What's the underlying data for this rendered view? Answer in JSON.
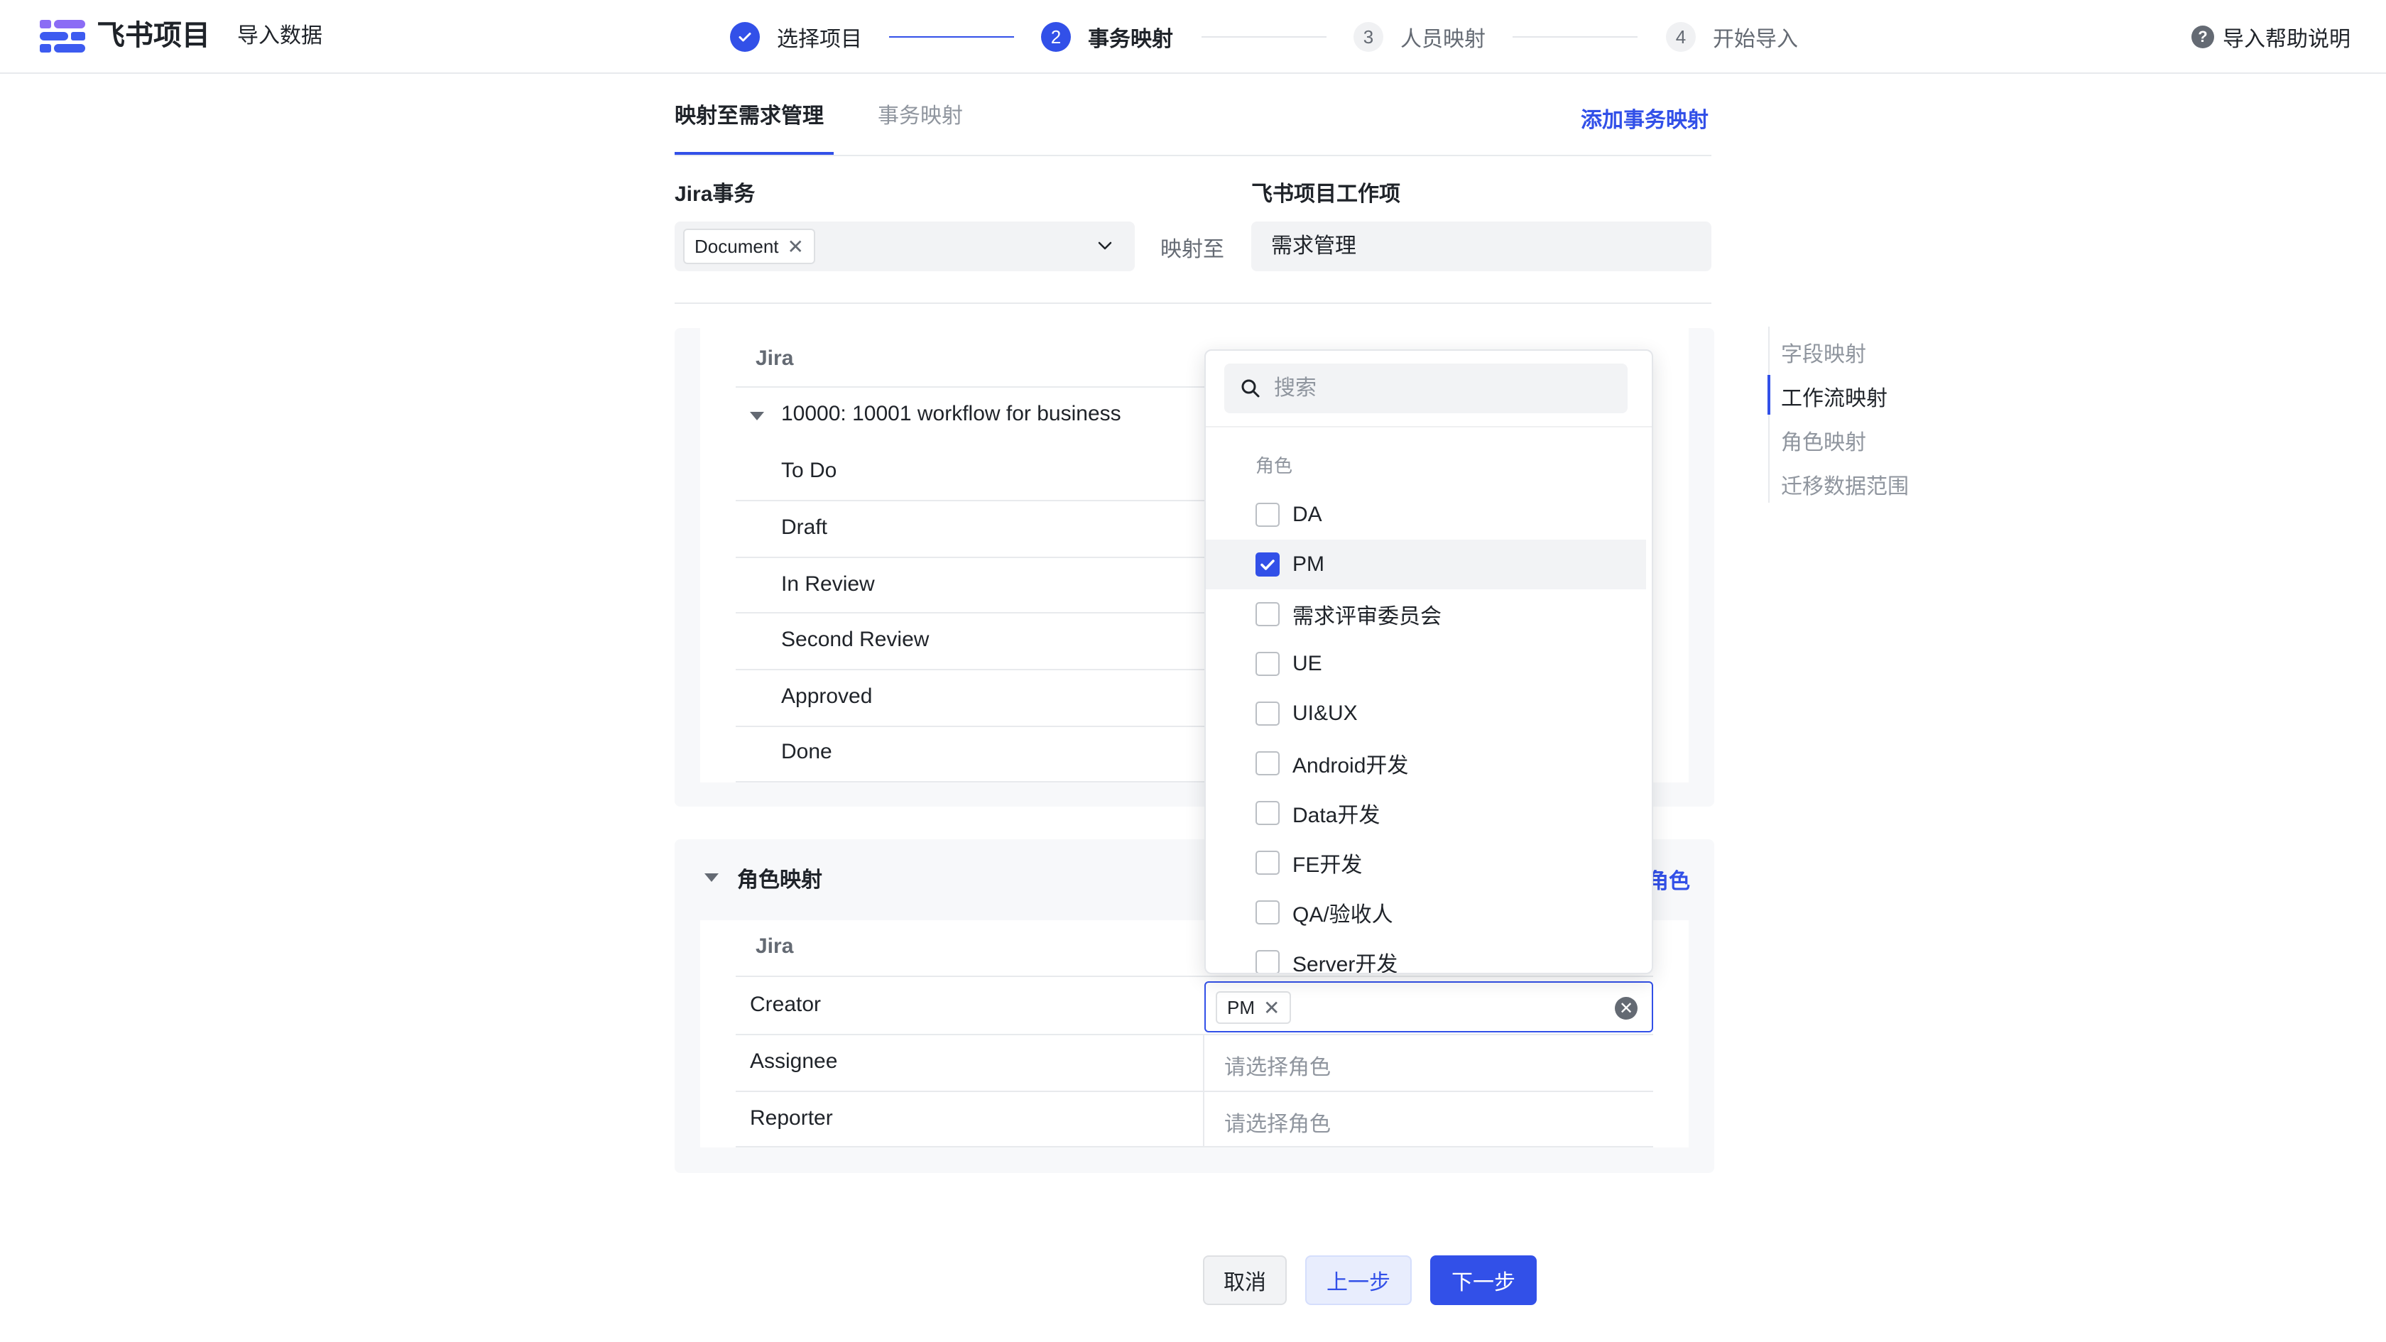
{
  "header": {
    "app_title": "飞书项目",
    "subtitle": "导入数据",
    "help": "导入帮助说明",
    "steps": [
      {
        "num": "✓",
        "label": "选择项目",
        "state": "done"
      },
      {
        "num": "2",
        "label": "事务映射",
        "state": "active"
      },
      {
        "num": "3",
        "label": "人员映射",
        "state": "todo"
      },
      {
        "num": "4",
        "label": "开始导入",
        "state": "todo"
      }
    ]
  },
  "tabs": [
    {
      "label": "映射至需求管理",
      "active": true
    },
    {
      "label": "事务映射",
      "active": false
    }
  ],
  "add_mapping": "添加事务映射",
  "jira_issue": {
    "label": "Jira事务",
    "tag": "Document",
    "map_to": "映射至"
  },
  "target": {
    "label": "飞书项目工作项",
    "value": "需求管理"
  },
  "workflow": {
    "col_jira": "Jira",
    "workflow_name": "10000: 10001 workflow for business",
    "statuses": [
      "To Do",
      "Draft",
      "In Review",
      "Second Review",
      "Approved",
      "Done"
    ]
  },
  "anchor_nav": [
    {
      "label": "字段映射",
      "active": false
    },
    {
      "label": "工作流映射",
      "active": true
    },
    {
      "label": "角色映射",
      "active": false
    },
    {
      "label": "迁移数据范围",
      "active": false
    }
  ],
  "role_mapping": {
    "title": "角色映射",
    "add_role_fragment": "角色",
    "col_jira": "Jira",
    "rows": [
      {
        "jira": "Creator",
        "value_tag": "PM"
      },
      {
        "jira": "Assignee",
        "placeholder": "请选择角色"
      },
      {
        "jira": "Reporter",
        "placeholder": "请选择角色"
      }
    ]
  },
  "dropdown": {
    "search_placeholder": "搜索",
    "group_label": "角色",
    "options": [
      {
        "label": "DA",
        "checked": false
      },
      {
        "label": "PM",
        "checked": true
      },
      {
        "label": "需求评审委员会",
        "checked": false
      },
      {
        "label": "UE",
        "checked": false
      },
      {
        "label": "UI&UX",
        "checked": false
      },
      {
        "label": "Android开发",
        "checked": false
      },
      {
        "label": "Data开发",
        "checked": false
      },
      {
        "label": "FE开发",
        "checked": false
      },
      {
        "label": "QA/验收人",
        "checked": false
      },
      {
        "label": "Server开发",
        "checked": false
      }
    ]
  },
  "footer": {
    "cancel": "取消",
    "prev": "上一步",
    "next": "下一步"
  },
  "colors": {
    "accent": "#3250e8",
    "text": "#1f2329",
    "muted": "#8f959e",
    "panel_bg": "#f7f8fa"
  }
}
